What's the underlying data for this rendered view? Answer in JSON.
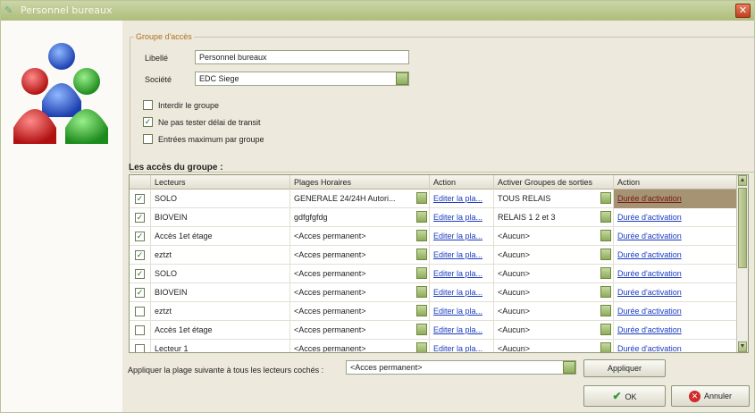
{
  "window": {
    "title": "Personnel bureaux"
  },
  "groupbox": {
    "title": "Groupe d'accès"
  },
  "form": {
    "libelle_label": "Libellé",
    "libelle_value": "Personnel bureaux",
    "societe_label": "Société",
    "societe_value": "EDC Siege",
    "checks": [
      {
        "label": "Interdir le groupe",
        "checked": false
      },
      {
        "label": "Ne pas tester délai de transit",
        "checked": true
      },
      {
        "label": "Entrées maximum par groupe",
        "checked": false
      }
    ]
  },
  "grid": {
    "title": "Les accès du groupe :",
    "headers": [
      "Lecteurs",
      "Plages Horaires",
      "Action",
      "Activer Groupes de sorties",
      "Action"
    ],
    "rows": [
      {
        "checked": true,
        "lecteur": "SOLO",
        "plage": "GENERALE 24/24H Autori...",
        "action": "Editer la pla...",
        "groupe": "TOUS RELAIS",
        "action2": "Durée d'activation"
      },
      {
        "checked": true,
        "lecteur": "BIOVEIN",
        "plage": "gdfgfgfdg",
        "action": "Editer la pla...",
        "groupe": "RELAIS 1 2 et 3",
        "action2": "Durée d'activation"
      },
      {
        "checked": true,
        "lecteur": "Accès 1et étage",
        "plage": "<Acces permanent>",
        "action": "Editer la pla...",
        "groupe": "<Aucun>",
        "action2": "Durée d'activation"
      },
      {
        "checked": true,
        "lecteur": "eztzt",
        "plage": "<Acces permanent>",
        "action": "Editer la pla...",
        "groupe": "<Aucun>",
        "action2": "Durée d'activation"
      },
      {
        "checked": true,
        "lecteur": "SOLO",
        "plage": "<Acces permanent>",
        "action": "Editer la pla...",
        "groupe": "<Aucun>",
        "action2": "Durée d'activation"
      },
      {
        "checked": true,
        "lecteur": "BIOVEIN",
        "plage": "<Acces permanent>",
        "action": "Editer la pla...",
        "groupe": "<Aucun>",
        "action2": "Durée d'activation"
      },
      {
        "checked": false,
        "lecteur": "eztzt",
        "plage": "<Acces permanent>",
        "action": "Editer la pla...",
        "groupe": "<Aucun>",
        "action2": "Durée d'activation"
      },
      {
        "checked": false,
        "lecteur": "Accès 1et étage",
        "plage": "<Acces permanent>",
        "action": "Editer la pla...",
        "groupe": "<Aucun>",
        "action2": "Durée d'activation"
      },
      {
        "checked": false,
        "lecteur": "Lecteur 1",
        "plage": "<Acces permanent>",
        "action": "Editer la pla...",
        "groupe": "<Aucun>",
        "action2": "Durée d'activation"
      }
    ]
  },
  "bottom": {
    "apply_label": "Appliquer la plage suivante à tous les lecteurs cochés :",
    "apply_value": "<Acces permanent>",
    "apply_button": "Appliquer",
    "ok_button": "OK",
    "cancel_button": "Annuler"
  },
  "colors": {
    "accent": "#8fac5b",
    "selected": "#a59374",
    "link": "#1a3cc0"
  }
}
